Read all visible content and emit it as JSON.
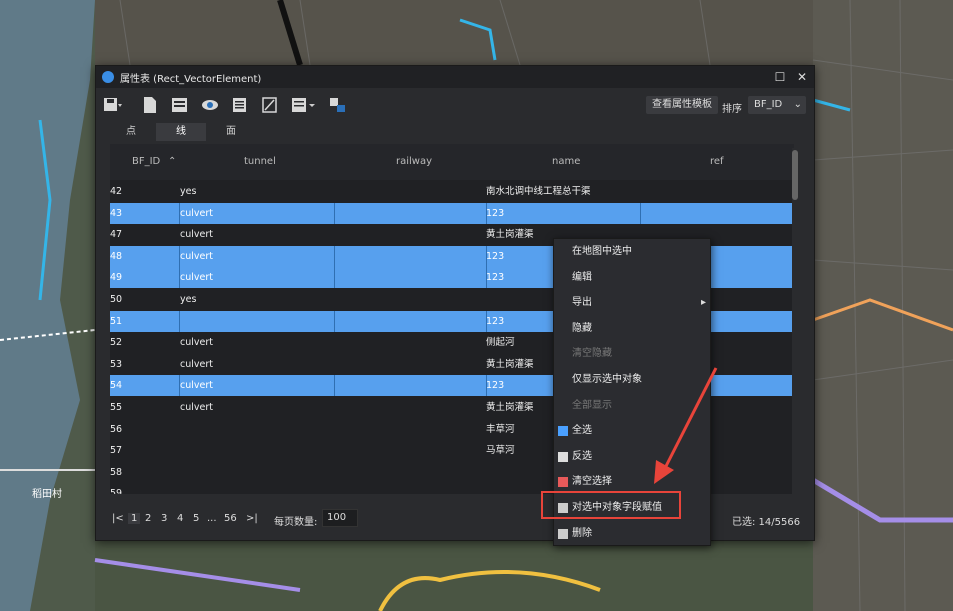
{
  "window": {
    "title": "属性表 (Rect_VectorElement)"
  },
  "toolbar": {
    "template_label": "查看属性模板",
    "sort_label": "排序",
    "sort_value": "BF_ID"
  },
  "tabs": [
    {
      "label": "点"
    },
    {
      "label": "线"
    },
    {
      "label": "面"
    }
  ],
  "table": {
    "headers": [
      "BF_ID",
      "tunnel",
      "railway",
      "name",
      "ref"
    ],
    "rows": [
      {
        "id": "42",
        "tunnel": "yes",
        "name": "南水北调中线工程总干渠",
        "selected": false
      },
      {
        "id": "43",
        "tunnel": "culvert",
        "name": "123",
        "selected": true
      },
      {
        "id": "47",
        "tunnel": "culvert",
        "name": "黄土岗灌渠",
        "selected": false
      },
      {
        "id": "48",
        "tunnel": "culvert",
        "name": "123",
        "selected": true
      },
      {
        "id": "49",
        "tunnel": "culvert",
        "name": "123",
        "selected": true
      },
      {
        "id": "50",
        "tunnel": "yes",
        "name": "",
        "selected": false
      },
      {
        "id": "51",
        "tunnel": "",
        "name": "123",
        "selected": true
      },
      {
        "id": "52",
        "tunnel": "culvert",
        "name": "侧起河",
        "selected": false
      },
      {
        "id": "53",
        "tunnel": "culvert",
        "name": "黄土岗灌渠",
        "selected": false
      },
      {
        "id": "54",
        "tunnel": "culvert",
        "name": "123",
        "selected": true
      },
      {
        "id": "55",
        "tunnel": "culvert",
        "name": "黄土岗灌渠",
        "selected": false
      },
      {
        "id": "56",
        "tunnel": "",
        "name": "丰草河",
        "selected": false
      },
      {
        "id": "57",
        "tunnel": "",
        "name": "马草河",
        "selected": false
      },
      {
        "id": "58",
        "tunnel": "",
        "name": "",
        "selected": false
      },
      {
        "id": "59",
        "tunnel": "",
        "name": "",
        "selected": false
      }
    ]
  },
  "footer": {
    "pages": [
      "1",
      "2",
      "3",
      "4",
      "5",
      "...",
      "56"
    ],
    "per_page_label": "每页数量:",
    "per_page_value": "100",
    "selected_count": "已选: 14/5566"
  },
  "context_menu": {
    "items": [
      {
        "label": "在地图中选中",
        "disabled": false
      },
      {
        "label": "编辑",
        "disabled": false
      },
      {
        "label": "导出",
        "disabled": false
      },
      {
        "label": "隐藏",
        "disabled": false
      },
      {
        "label": "清空隐藏",
        "disabled": true
      },
      {
        "label": "仅显示选中对象",
        "disabled": false
      },
      {
        "label": "全部显示",
        "disabled": true
      },
      {
        "label": "全选",
        "disabled": false
      },
      {
        "label": "反选",
        "disabled": false
      },
      {
        "label": "清空选择",
        "disabled": false
      },
      {
        "label": "对选中对象字段赋值",
        "disabled": false
      },
      {
        "label": "删除",
        "disabled": false
      }
    ]
  },
  "map": {
    "label": "稻田村"
  },
  "colors": {
    "selection": "#57a0ee",
    "highlight": "#e8443a",
    "window_bg": "#2a2b2e"
  }
}
